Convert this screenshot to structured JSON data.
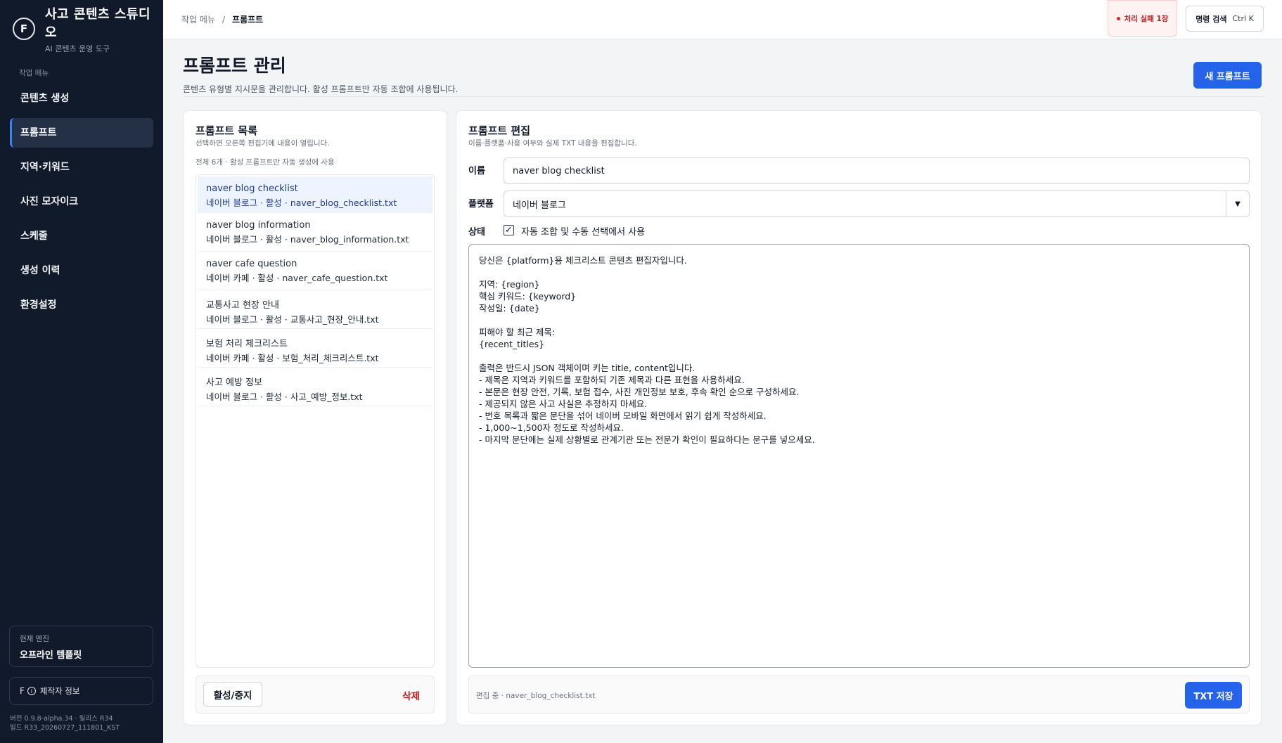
{
  "brand": {
    "logo": "F",
    "title": "사고 콘텐츠 스튜디오",
    "subtitle": "AI 콘텐츠 운영 도구"
  },
  "sidebar": {
    "section_label": "작업 메뉴",
    "items": [
      {
        "label": "콘텐츠 생성",
        "active": false
      },
      {
        "label": "프롬프트",
        "active": true
      },
      {
        "label": "지역·키워드",
        "active": false
      },
      {
        "label": "사진 모자이크",
        "active": false
      },
      {
        "label": "스케줄",
        "active": false
      },
      {
        "label": "생성 이력",
        "active": false
      },
      {
        "label": "환경설정",
        "active": false
      }
    ],
    "engine": {
      "label": "현재 엔진",
      "value": "오프라인 템플릿"
    },
    "credit_label": "제작자 정보",
    "version_line1": "버전 0.9.8-alpha.34 · 릴리스 R34",
    "version_line2": "빌드 R33_20260727_111801_KST"
  },
  "topbar": {
    "breadcrumb_root": "작업 메뉴",
    "breadcrumb_sep": "/",
    "breadcrumb_current": "프롬프트",
    "fail_badge": "처리 실패 1장",
    "command_label": "명령 검색",
    "command_shortcut": "Ctrl K"
  },
  "page": {
    "title": "프롬프트 관리",
    "description": "콘텐츠 유형별 지시문을 관리합니다. 활성 프롬프트만 자동 조합에 사용됩니다.",
    "new_button": "새 프롬프트"
  },
  "list_panel": {
    "title": "프롬프트 목록",
    "subtitle": "선택하면 오른쪽 편집기에 내용이 열립니다.",
    "count_text": "전체 6개 · 활성 프롬프트만 자동 생성에 사용",
    "items": [
      {
        "name": "naver blog checklist",
        "meta": "네이버 블로그 · 활성 · naver_blog_checklist.txt"
      },
      {
        "name": "naver blog information",
        "meta": "네이버 블로그 · 활성 · naver_blog_information.txt"
      },
      {
        "name": "naver cafe question",
        "meta": "네이버 카페 · 활성 · naver_cafe_question.txt"
      },
      {
        "name": "교통사고 현장 안내",
        "meta": "네이버 블로그 · 활성 · 교통사고_현장_안내.txt"
      },
      {
        "name": "보험 처리 체크리스트",
        "meta": "네이버 카페 · 활성 · 보험_처리_체크리스트.txt"
      },
      {
        "name": "사고 예방 정보",
        "meta": "네이버 블로그 · 활성 · 사고_예방_정보.txt"
      }
    ],
    "toggle_button": "활성/중지",
    "delete_button": "삭제"
  },
  "edit_panel": {
    "title": "프롬프트 편집",
    "subtitle": "이름·플랫폼·사용 여부와 실제 TXT 내용을 편집합니다.",
    "name_label": "이름",
    "name_value": "naver blog checklist",
    "platform_label": "플랫폼",
    "platform_value": "네이버 블로그",
    "status_label": "상태",
    "checkbox_mark": "✓",
    "status_checkbox_label": "자동 조합 및 수동 선택에서 사용",
    "content": "당신은 {platform}용 체크리스트 콘텐츠 편집자입니다.\n\n지역: {region}\n핵심 키워드: {keyword}\n작성일: {date}\n\n피해야 할 최근 제목:\n{recent_titles}\n\n출력은 반드시 JSON 객체이며 키는 title, content입니다.\n- 제목은 지역과 키워드를 포함하되 기존 제목과 다른 표현을 사용하세요.\n- 본문은 현장 안전, 기록, 보험 접수, 사진 개인정보 보호, 후속 확인 순으로 구성하세요.\n- 제공되지 않은 사고 사실은 추정하지 마세요.\n- 번호 목록과 짧은 문단을 섞어 네이버 모바일 화면에서 읽기 쉽게 작성하세요.\n- 1,000~1,500자 정도로 작성하세요.\n- 마지막 문단에는 실제 상황별로 관계기관 또는 전문가 확인이 필요하다는 문구를 넣으세요.",
    "editing_status": "편집 중 · naver_blog_checklist.txt",
    "save_button": "TXT 저장"
  }
}
